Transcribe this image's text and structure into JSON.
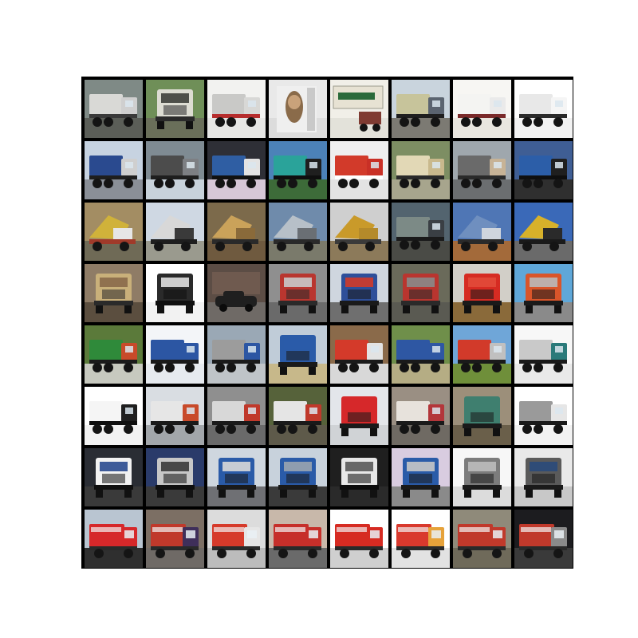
{
  "grid": {
    "rows": 8,
    "cols": 8,
    "tiles": [
      {
        "label": "",
        "bg": "#7f8a86",
        "ground": "#5b5e58",
        "body": "#d9d9d6",
        "cab": "#cfcfcf",
        "accent": "#3a3a3a",
        "view": "side"
      },
      {
        "label": "",
        "bg": "#6f8f58",
        "ground": "#6a6f5a",
        "body": "#dcdcd2",
        "cab": "#3d3f3a",
        "accent": "#2a2a2a",
        "view": "front"
      },
      {
        "label": "",
        "bg": "#f2f2f0",
        "ground": "#e6e6e4",
        "body": "#c9c9c7",
        "cab": "#d8d8d6",
        "accent": "#b62d2d",
        "view": "side"
      },
      {
        "label": "",
        "bg": "#e9e9e9",
        "ground": "#dcdcdc",
        "body": "#8a6b4a",
        "cab": "#c9a27a",
        "accent": "#4b3a2a",
        "view": "portrait"
      },
      {
        "label": "",
        "bg": "#f1efe8",
        "ground": "#e3e2da",
        "body": "#e7e2d3",
        "cab": "#2a6a3a",
        "accent": "#1f5a2f",
        "view": "sign"
      },
      {
        "label": "",
        "bg": "#c9d4dd",
        "ground": "#7c7a73",
        "body": "#c7c49b",
        "cab": "#5b6470",
        "accent": "#1f1f1f",
        "view": "side"
      },
      {
        "label": "",
        "bg": "#f7f6f3",
        "ground": "#e9e6df",
        "body": "#f4f4f2",
        "cab": "#eaeaea",
        "accent": "#7a2a2a",
        "view": "side"
      },
      {
        "label": "",
        "bg": "#ffffff",
        "ground": "#f2f2f2",
        "body": "#e8e8e8",
        "cab": "#f5f5f5",
        "accent": "#2b2b2b",
        "view": "side"
      },
      {
        "label": "",
        "bg": "#c7d3e1",
        "ground": "#8a8f97",
        "body": "#2a4a8f",
        "cab": "#cfcfcf",
        "accent": "#1e1e1e",
        "view": "side"
      },
      {
        "label": "",
        "bg": "#7f8b93",
        "ground": "#c8d2da",
        "body": "#4c4c4c",
        "cab": "#7d7f83",
        "accent": "#1e1e1e",
        "view": "side"
      },
      {
        "label": "",
        "bg": "#2e2f36",
        "ground": "#d6c7d6",
        "body": "#2f5ea3",
        "cab": "#e3e3e3",
        "accent": "#111111",
        "view": "side"
      },
      {
        "label": "",
        "bg": "#4c82b8",
        "ground": "#3d6b39",
        "body": "#2aa39a",
        "cab": "#1f1f1f",
        "accent": "#0f0f0f",
        "view": "side"
      },
      {
        "label": "",
        "bg": "#efefef",
        "ground": "#e3e3e3",
        "body": "#d23a2a",
        "cab": "#c93026",
        "accent": "#ffffff",
        "view": "side"
      },
      {
        "label": "",
        "bg": "#7d8e63",
        "ground": "#a7a58d",
        "body": "#e2d8b6",
        "cab": "#c9b98d",
        "accent": "#2a2a2a",
        "view": "side"
      },
      {
        "label": "",
        "bg": "#9fa7ad",
        "ground": "#6b6e70",
        "body": "#6a6a6a",
        "cab": "#c7b396",
        "accent": "#2a2a2a",
        "view": "side"
      },
      {
        "label": "",
        "bg": "#3f5e94",
        "ground": "#2f2f2f",
        "body": "#2c5ea8",
        "cab": "#1f1f1f",
        "accent": "#0f0f0f",
        "view": "side"
      },
      {
        "label": "",
        "bg": "#a38d63",
        "ground": "#6f6a56",
        "body": "#d0b23a",
        "cab": "#e6e6e6",
        "accent": "#a03a2a",
        "view": "dump"
      },
      {
        "label": "",
        "bg": "#cfd8e3",
        "ground": "#9a9a8e",
        "body": "#d8d8d8",
        "cab": "#3a3a3a",
        "accent": "#1e1e1e",
        "view": "dump"
      },
      {
        "label": "",
        "bg": "#7c6a4b",
        "ground": "#6f5a3f",
        "body": "#caa25a",
        "cab": "#8a6a3a",
        "accent": "#2a2a2a",
        "view": "dump"
      },
      {
        "label": "",
        "bg": "#6f8bab",
        "ground": "#7a7a6b",
        "body": "#b7c0c8",
        "cab": "#6a6f74",
        "accent": "#2a2a2a",
        "view": "dump"
      },
      {
        "label": "",
        "bg": "#cfcfcf",
        "ground": "#8c7a5a",
        "body": "#c99a2a",
        "cab": "#b48a2a",
        "accent": "#3a3a3a",
        "view": "dump"
      },
      {
        "label": "",
        "bg": "#53646f",
        "ground": "#4a4b46",
        "body": "#7c8a86",
        "cab": "#3a3f44",
        "accent": "#1a1a1a",
        "view": "side"
      },
      {
        "label": "",
        "bg": "#4f76b5",
        "ground": "#a36a3a",
        "body": "#6f8fbf",
        "cab": "#cfd5dd",
        "accent": "#2a2a2a",
        "view": "dump"
      },
      {
        "label": "",
        "bg": "#3a69b8",
        "ground": "#6a6a6a",
        "body": "#d7b12a",
        "cab": "#2a2a2a",
        "accent": "#1a1a1a",
        "view": "dump"
      },
      {
        "label": "",
        "bg": "#8f7c66",
        "ground": "#5b4e3f",
        "body": "#c9b07a",
        "cab": "#8a6a4a",
        "accent": "#2a2a2a",
        "view": "front"
      },
      {
        "label": "",
        "bg": "#ffffff",
        "ground": "#f2f2f2",
        "body": "#2a2a2a",
        "cab": "#e0e0e0",
        "accent": "#0f0f0f",
        "view": "front"
      },
      {
        "label": "",
        "bg": "#5c4d45",
        "ground": "#6f6a66",
        "body": "#1f1f1f",
        "cab": "#8a6a5a",
        "accent": "#0f0f0f",
        "view": "car"
      },
      {
        "label": "",
        "bg": "#8f8f8f",
        "ground": "#6a6a6a",
        "body": "#b9362f",
        "cab": "#c9c9c9",
        "accent": "#2a2a2a",
        "view": "front"
      },
      {
        "label": "",
        "bg": "#cfd6df",
        "ground": "#6f6f6f",
        "body": "#2e4f9a",
        "cab": "#d03a2a",
        "accent": "#1a1a1a",
        "view": "front"
      },
      {
        "label": "",
        "bg": "#6a6a5a",
        "ground": "#5a5a52",
        "body": "#b9352f",
        "cab": "#8a8a8a",
        "accent": "#2a2a2a",
        "view": "front"
      },
      {
        "label": "",
        "bg": "#d2cfc8",
        "ground": "#8a6a3a",
        "body": "#d62b22",
        "cab": "#e24a3a",
        "accent": "#1a1a1a",
        "view": "front"
      },
      {
        "label": "",
        "bg": "#5fa7d8",
        "ground": "#8a8a8a",
        "body": "#d9552a",
        "cab": "#b9b9b9",
        "accent": "#1a1a1a",
        "view": "front"
      },
      {
        "label": "",
        "bg": "#5b7a3a",
        "ground": "#c7c9bf",
        "body": "#2f8a3a",
        "cab": "#c84a2a",
        "accent": "#1a1a1a",
        "view": "side"
      },
      {
        "label": "",
        "bg": "#f3f5f8",
        "ground": "#e6eaef",
        "body": "#2c56a3",
        "cab": "#2c56a3",
        "accent": "#1a1a1a",
        "view": "side"
      },
      {
        "label": "",
        "bg": "#9aa8b5",
        "ground": "#bfc4c8",
        "body": "#9c9c9c",
        "cab": "#2c56a3",
        "accent": "#1a1a1a",
        "view": "side"
      },
      {
        "label": "",
        "bg": "#c0ccd8",
        "ground": "#c7b88a",
        "body": "#2a5ba8",
        "cab": "#2a5ba8",
        "accent": "#1a1a1a",
        "view": "front"
      },
      {
        "label": "",
        "bg": "#8a6a4a",
        "ground": "#d8d8d8",
        "body": "#d43a2a",
        "cab": "#e3e3e3",
        "accent": "#1a1a1a",
        "view": "side"
      },
      {
        "label": "",
        "bg": "#6f8f4a",
        "ground": "#b5ad84",
        "body": "#2e57a3",
        "cab": "#2e57a3",
        "accent": "#1a1a1a",
        "view": "side"
      },
      {
        "label": "",
        "bg": "#6fa6d8",
        "ground": "#6f8f3a",
        "body": "#d23a2a",
        "cab": "#c0c0c0",
        "accent": "#1a1a1a",
        "view": "side"
      },
      {
        "label": "",
        "bg": "#f7f7f7",
        "ground": "#e9e9e9",
        "body": "#c9c9c9",
        "cab": "#2a7a7a",
        "accent": "#1a1a1a",
        "view": "side"
      },
      {
        "label": "",
        "bg": "#ffffff",
        "ground": "#f2f2f2",
        "body": "#f5f5f5",
        "cab": "#1f1f1f",
        "accent": "#0f0f0f",
        "view": "side"
      },
      {
        "label": "",
        "bg": "#d9dde2",
        "ground": "#a2a6aa",
        "body": "#e6e6e6",
        "cab": "#c84a2a",
        "accent": "#1a1a1a",
        "view": "side"
      },
      {
        "label": "",
        "bg": "#8f8f8f",
        "ground": "#6a6a6a",
        "body": "#d8d8d8",
        "cab": "#c0392b",
        "accent": "#1a1a1a",
        "view": "side"
      },
      {
        "label": "",
        "bg": "#56623a",
        "ground": "#5e5a4a",
        "body": "#e5e5e5",
        "cab": "#c0392b",
        "accent": "#1a1a1a",
        "view": "side"
      },
      {
        "label": "",
        "bg": "#e3e6ea",
        "ground": "#d0d3d6",
        "body": "#d6282a",
        "cab": "#d6282a",
        "accent": "#1a1a1a",
        "view": "front"
      },
      {
        "label": "",
        "bg": "#9a8f83",
        "ground": "#6f6a63",
        "body": "#e7e2dc",
        "cab": "#b3363a",
        "accent": "#1a1a1a",
        "view": "side"
      },
      {
        "label": "",
        "bg": "#9c8f7a",
        "ground": "#6a5f4a",
        "body": "#3f7f6f",
        "cab": "#3f7f6f",
        "accent": "#1a1a1a",
        "view": "front"
      },
      {
        "label": "",
        "bg": "#ffffff",
        "ground": "#f2f2f2",
        "body": "#9a9a9a",
        "cab": "#e6e6e6",
        "accent": "#1a1a1a",
        "view": "side"
      },
      {
        "label": "",
        "bg": "#2a2d34",
        "ground": "#3a3a3a",
        "body": "#f2f2f2",
        "cab": "#2a4a8f",
        "accent": "#0f0f0f",
        "view": "front"
      },
      {
        "label": "",
        "bg": "#2a3b6a",
        "ground": "#3a3a3a",
        "body": "#c7c7c7",
        "cab": "#3a3a3a",
        "accent": "#0f0f0f",
        "view": "front"
      },
      {
        "label": "",
        "bg": "#cfd7df",
        "ground": "#6f7074",
        "body": "#2a5ba8",
        "cab": "#d8d8d8",
        "accent": "#1a1a1a",
        "view": "front"
      },
      {
        "label": "",
        "bg": "#c8d2dc",
        "ground": "#3a3a3a",
        "body": "#2a5ba8",
        "cab": "#9aa4af",
        "accent": "#1a1a1a",
        "view": "front"
      },
      {
        "label": "",
        "bg": "#1f1f1f",
        "ground": "#2a2a2a",
        "body": "#e7e7e7",
        "cab": "#5a5a5a",
        "accent": "#0a0a0a",
        "view": "front"
      },
      {
        "label": "",
        "bg": "#d9cce0",
        "ground": "#8a8a8a",
        "body": "#2a5ba8",
        "cab": "#c7c7c7",
        "accent": "#1a1a1a",
        "view": "front"
      },
      {
        "label": "",
        "bg": "#f7f7f7",
        "ground": "#dcdcdc",
        "body": "#7c7c7c",
        "cab": "#bcbcbc",
        "accent": "#1a1a1a",
        "view": "front"
      },
      {
        "label": "",
        "bg": "#e9e9e9",
        "ground": "#c8c8c8",
        "body": "#5a5a5a",
        "cab": "#2a4a7a",
        "accent": "#1a1a1a",
        "view": "front"
      },
      {
        "label": "",
        "bg": "#b9c5d1",
        "ground": "#2f2f2f",
        "body": "#d6282a",
        "cab": "#d6282a",
        "accent": "#1a1a1a",
        "view": "fire"
      },
      {
        "label": "",
        "bg": "#7c6f64",
        "ground": "#6f6a66",
        "body": "#c0392b",
        "cab": "#3f2f5a",
        "accent": "#1a1a1a",
        "view": "fire"
      },
      {
        "label": "",
        "bg": "#dcdcdc",
        "ground": "#bcbcbc",
        "body": "#d63a2a",
        "cab": "#e6e6e6",
        "accent": "#1a1a1a",
        "view": "fire"
      },
      {
        "label": "",
        "bg": "#c8b8aa",
        "ground": "#6a6a6a",
        "body": "#c62f2a",
        "cab": "#c62f2a",
        "accent": "#1a1a1a",
        "view": "fire"
      },
      {
        "label": "",
        "bg": "#ffffff",
        "ground": "#cfcfcf",
        "body": "#d62b22",
        "cab": "#d62b22",
        "accent": "#1a1a1a",
        "view": "fire"
      },
      {
        "label": "",
        "bg": "#ffffff",
        "ground": "#e2e2e2",
        "body": "#d9392d",
        "cab": "#e6a23a",
        "accent": "#1a1a1a",
        "view": "fire"
      },
      {
        "label": "",
        "bg": "#8f8a7a",
        "ground": "#6f6a5a",
        "body": "#c0392b",
        "cab": "#c0392b",
        "accent": "#1a1a1a",
        "view": "fire"
      },
      {
        "label": "",
        "bg": "#1c1c1f",
        "ground": "#3a3a3a",
        "body": "#c0392b",
        "cab": "#8a8a8a",
        "accent": "#0f0f0f",
        "view": "fire"
      }
    ]
  }
}
